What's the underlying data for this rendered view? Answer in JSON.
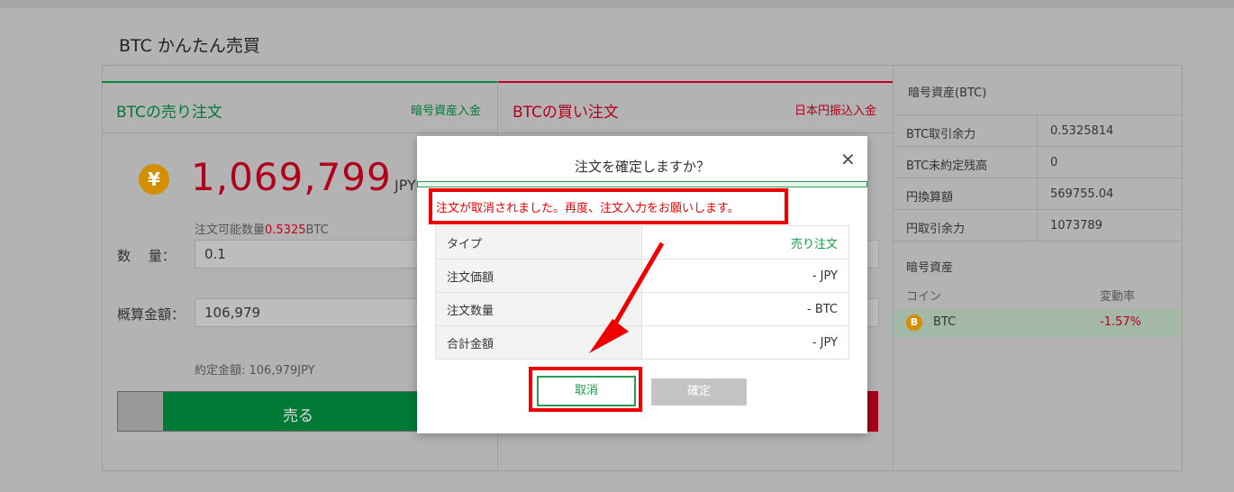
{
  "page": {
    "title": "BTC かんたん売買"
  },
  "sell": {
    "title": "BTCの売り注文",
    "deposit_link": "暗号資産入金",
    "yen_icon": "¥",
    "price": "1,069,799",
    "price_unit": "JPY",
    "avail_label": "注文可能数量",
    "avail_value": "0.5325",
    "avail_unit": "BTC",
    "qty_label": "数　 量：",
    "qty_value": "0.1",
    "approx_label": "概算金額：",
    "approx_value": "106,979",
    "settle_text": "約定金額: 106,979JPY",
    "sell_button": "売る"
  },
  "buy": {
    "title": "BTCの買い注文",
    "deposit_link": "日本円振込入金"
  },
  "side": {
    "header": "暗号資産(BTC)",
    "rows": [
      {
        "k": "BTC取引余力",
        "v": "0.5325814"
      },
      {
        "k": "BTC未約定残高",
        "v": "0"
      },
      {
        "k": "円換算額",
        "v": "569755.04"
      },
      {
        "k": "円取引余力",
        "v": "1073789"
      }
    ],
    "assets_title": "暗号資産",
    "coin_header": "コイン",
    "rate_header": "変動率",
    "btc_name": "BTC",
    "btc_rate": "-1.57%",
    "btc_icon": "B"
  },
  "modal": {
    "title": "注文を確定しますか？",
    "close": "✕",
    "alert": "注文が取消されました。再度、注文入力をお願いします。",
    "rows": [
      {
        "k": "タイプ",
        "v": "売り注文"
      },
      {
        "k": "注文価額",
        "v": "- JPY"
      },
      {
        "k": "注文数量",
        "v": "- BTC"
      },
      {
        "k": "合計金額",
        "v": "- JPY"
      }
    ],
    "cancel": "取消",
    "confirm": "確定"
  },
  "colors": {
    "sell_green": "#007a36",
    "buy_red": "#b0001c",
    "alert_red": "#ee0000"
  }
}
